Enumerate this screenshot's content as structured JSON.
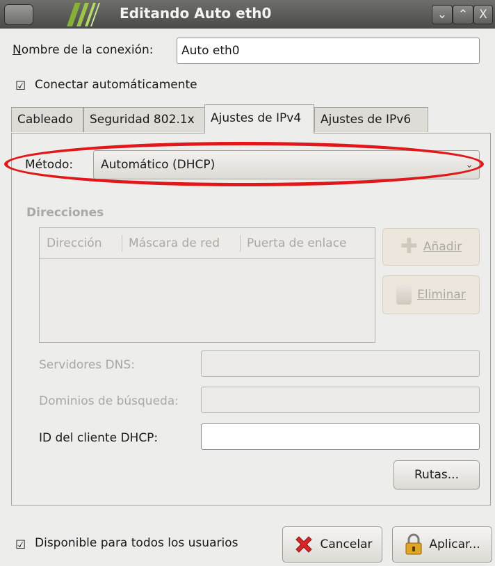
{
  "window": {
    "title": "Editando Auto eth0",
    "controls": [
      "minimize",
      "maximize",
      "close"
    ]
  },
  "connection": {
    "name_label": "Nombre de la conexión:",
    "name_value": "Auto eth0",
    "auto_connect_label": "Conectar automáticamente",
    "auto_connect_checked": true
  },
  "tabs": [
    {
      "label": "Cableado",
      "active": false
    },
    {
      "label": "Seguridad 802.1x",
      "active": false
    },
    {
      "label": "Ajustes de IPv4",
      "active": true
    },
    {
      "label": "Ajustes de IPv6",
      "active": false
    }
  ],
  "ipv4": {
    "method_label": "Método:",
    "method_value": "Automático (DHCP)",
    "addresses_title": "Direcciones",
    "columns": [
      "Dirección",
      "Máscara de red",
      "Puerta de enlace"
    ],
    "add_button": "Añadir",
    "delete_button": "Eliminar",
    "dns_label": "Servidores DNS:",
    "dns_value": "",
    "search_domains_label": "Dominios de búsqueda:",
    "search_domains_value": "",
    "dhcp_client_id_label": "ID del cliente DHCP:",
    "dhcp_client_id_value": "",
    "routes_button": "Rutas..."
  },
  "footer": {
    "all_users_label": "Disponible para todos los usuarios",
    "all_users_checked": true,
    "cancel_button": "Cancelar",
    "apply_button": "Aplicar..."
  },
  "annotation": {
    "color": "#e1171a"
  }
}
